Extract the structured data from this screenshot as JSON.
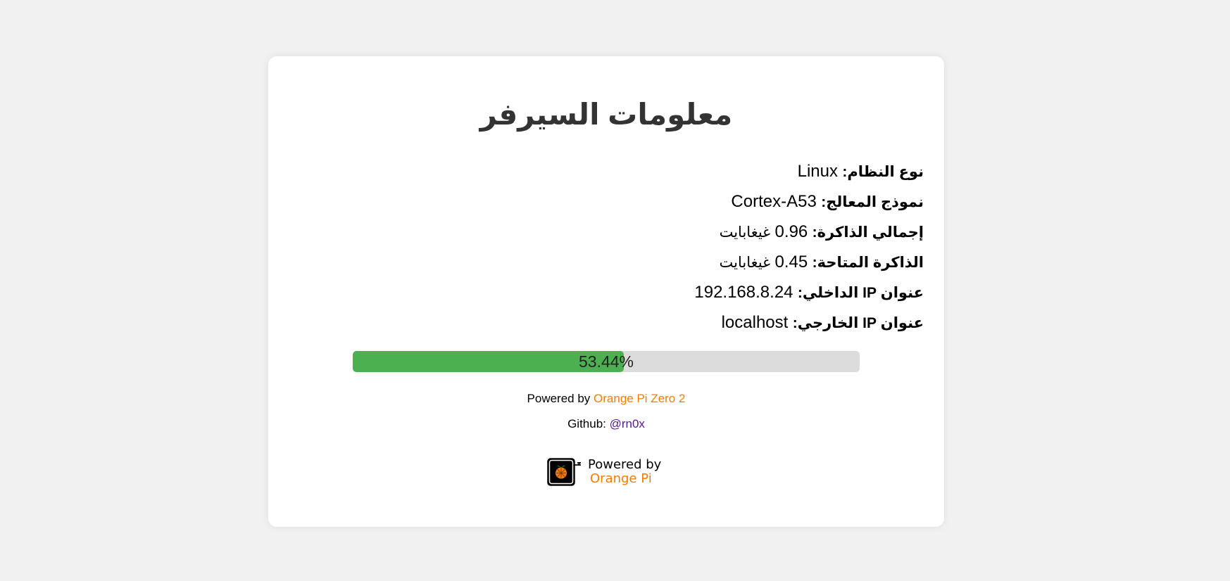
{
  "page": {
    "title": "معلومات السيرفر"
  },
  "info": {
    "rows": [
      {
        "label": "نوع النظام:",
        "value": "Linux",
        "unit": ""
      },
      {
        "label": "نموذج المعالج:",
        "value": "Cortex-A53",
        "unit": ""
      },
      {
        "label": "إجمالي الذاكرة:",
        "value": "0.96",
        "unit": "غيغابايت"
      },
      {
        "label": "الذاكرة المتاحة:",
        "value": "0.45",
        "unit": "غيغابايت"
      },
      {
        "label": "عنوان IP الداخلي:",
        "value": "192.168.8.24",
        "unit": ""
      },
      {
        "label": "عنوان IP الخارجي:",
        "value": "localhost",
        "unit": ""
      }
    ]
  },
  "progress": {
    "percent": 53.44,
    "label": "53.44%",
    "fill_color": "#4caf50",
    "track_color": "#dcdcdc"
  },
  "footer": {
    "powered_prefix": "Powered by",
    "powered_link": "Orange Pi Zero 2",
    "github_prefix": "Github:",
    "github_link": "@rn0x"
  },
  "badge": {
    "icon": "orange-pi-board-icon",
    "line1": "Powered by",
    "line2": "Orange Pi"
  },
  "colors": {
    "background": "#f1f1f1",
    "card": "#ffffff",
    "accent_orange": "#f57c00",
    "link_purple": "#551a8b"
  }
}
